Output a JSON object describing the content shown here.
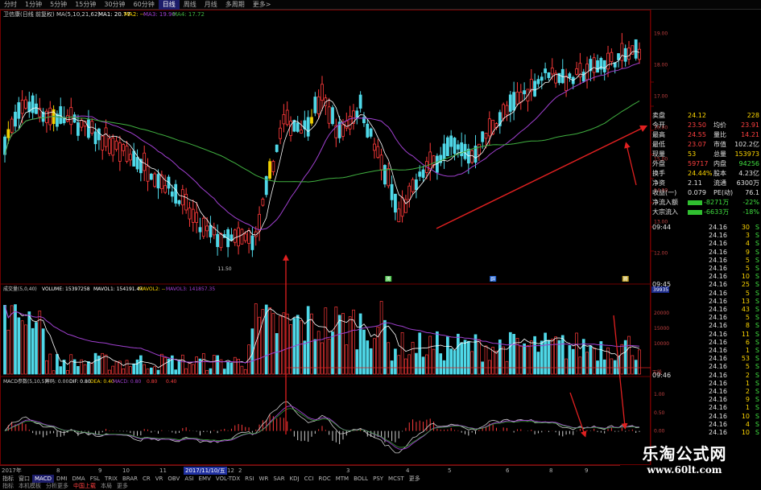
{
  "toolbar": {
    "periods": [
      "分时",
      "1分钟",
      "5分钟",
      "15分钟",
      "30分钟",
      "60分钟",
      "日线",
      "周线",
      "月线",
      "多周期",
      "更多>"
    ],
    "active_period": 6
  },
  "main_legend": {
    "stock_name": "卫信康(日线 前复权)",
    "ma_label": "MA(5,10,21,62)",
    "ma1": "MA1: 20.77",
    "ma2": "MA2: --",
    "ma3": "MA3: 19.90",
    "ma4": "MA4: 17.72"
  },
  "volume_legend": {
    "label": "成交量(5,0,40)",
    "volume": "VOLUME: 15397258",
    "mavol1": "MAVOL1: 154191.47",
    "mavol2": "MAVOL2: --",
    "mavol3": "MAVOL3: 141857.35"
  },
  "macd_legend": {
    "label": "MACD参数(5,10,5)",
    "chip": "筹码: 0.00",
    "dif": "DIF: 0.80",
    "dea": "DEA: 0.40",
    "macd": "MACD: 0.80",
    "extra1": "0.80",
    "extra2": "0.40"
  },
  "price_axis": {
    "ticks": [
      "19.00",
      "18.00",
      "17.00",
      "16.00",
      "15.00",
      "14.00",
      "13.00",
      "12.00"
    ],
    "low_label": "11.50"
  },
  "volume_axis": {
    "ticks": [
      "20000",
      "15000",
      "10000"
    ],
    "badge": "39935",
    "unit": "万股"
  },
  "macd_axis": {
    "ticks": [
      "1.00",
      "0.50",
      "0.00"
    ]
  },
  "event_markers": [
    "腾",
    "辟",
    "腾"
  ],
  "colors": {
    "up": "#ff3a3a",
    "down": "#4fd8e8",
    "yellow_candle": "#f0d000",
    "ma1": "#ffffff",
    "ma3": "#a040d0",
    "ma4": "#40b040",
    "arrow": "#e02020",
    "grid": "#700000"
  },
  "info": {
    "rows": [
      {
        "l": "卖盘",
        "v": "24.12",
        "r": "228",
        "vc": "#ffd700",
        "rc": "#ffd700"
      },
      {
        "l": "今开",
        "v": "23.50",
        "r2": "均价",
        "r": "23.91",
        "vc": "#ff4040",
        "rc": "#ff4040"
      },
      {
        "l": "最高",
        "v": "24.55",
        "r2": "量比",
        "r": "14.21",
        "vc": "#ff4040",
        "rc": "#ff4040"
      },
      {
        "l": "最低",
        "v": "23.07",
        "r2": "市值",
        "r": "102.2亿",
        "vc": "#ff4040",
        "rc": "#e0e0e0"
      },
      {
        "l": "现量",
        "v": "53",
        "r2": "总量",
        "r": "153973",
        "vc": "#ffd700",
        "rc": "#ffd700"
      },
      {
        "l": "外盘",
        "v": "59717",
        "r2": "内盘",
        "r": "94256",
        "vc": "#ff4040",
        "rc": "#40e040"
      },
      {
        "l": "换手",
        "v": "24.44%",
        "r2": "股本",
        "r": "4.23亿",
        "vc": "#ffd700",
        "rc": "#e0e0e0"
      },
      {
        "l": "净资",
        "v": "2.11",
        "r2": "流通",
        "r": "6300万",
        "vc": "#e0e0e0",
        "rc": "#e0e0e0"
      },
      {
        "l": "收益(一)",
        "v": "0.079",
        "r2": "PE(动)",
        "r": "76.1",
        "vc": "#e0e0e0",
        "rc": "#e0e0e0"
      },
      {
        "l": "净流入额",
        "v": "",
        "r2": "-8271万",
        "r": "-22%",
        "vc": "#40e040",
        "rc": "#40e040"
      },
      {
        "l": "大宗流入",
        "v": "",
        "r2": "-6633万",
        "r": "-18%",
        "vc": "#40e040",
        "rc": "#40e040"
      }
    ]
  },
  "ticks": {
    "rows": [
      {
        "t": "09:44",
        "p": "24.16",
        "v": "30",
        "s": "S"
      },
      {
        "t": "",
        "p": "24.16",
        "v": "3",
        "s": "S"
      },
      {
        "t": "",
        "p": "24.16",
        "v": "4",
        "s": "S"
      },
      {
        "t": "",
        "p": "24.16",
        "v": "9",
        "s": "S"
      },
      {
        "t": "",
        "p": "24.16",
        "v": "5",
        "s": "S"
      },
      {
        "t": "",
        "p": "24.16",
        "v": "5",
        "s": "S"
      },
      {
        "t": "",
        "p": "24.16",
        "v": "10",
        "s": "S"
      },
      {
        "t": "09:45",
        "p": "24.16",
        "v": "25",
        "s": "S"
      },
      {
        "t": "",
        "p": "24.16",
        "v": "5",
        "s": "S"
      },
      {
        "t": "",
        "p": "24.16",
        "v": "13",
        "s": "S"
      },
      {
        "t": "",
        "p": "24.16",
        "v": "43",
        "s": "S"
      },
      {
        "t": "",
        "p": "24.16",
        "v": "5",
        "s": "S"
      },
      {
        "t": "",
        "p": "24.16",
        "v": "8",
        "s": "S"
      },
      {
        "t": "",
        "p": "24.16",
        "v": "11",
        "s": "S"
      },
      {
        "t": "",
        "p": "24.16",
        "v": "6",
        "s": "S"
      },
      {
        "t": "",
        "p": "24.16",
        "v": "1",
        "s": "S"
      },
      {
        "t": "",
        "p": "24.16",
        "v": "53",
        "s": "S"
      },
      {
        "t": "",
        "p": "24.16",
        "v": "5",
        "s": "S"
      },
      {
        "t": "09:46",
        "p": "24.16",
        "v": "2",
        "s": "S"
      },
      {
        "t": "",
        "p": "24.16",
        "v": "1",
        "s": "S"
      },
      {
        "t": "",
        "p": "24.16",
        "v": "2",
        "s": "S"
      },
      {
        "t": "",
        "p": "24.16",
        "v": "9",
        "s": "S"
      },
      {
        "t": "",
        "p": "24.16",
        "v": "1",
        "s": "S"
      },
      {
        "t": "",
        "p": "24.16",
        "v": "10",
        "s": "S"
      },
      {
        "t": "",
        "p": "24.16",
        "v": "4",
        "s": "S"
      },
      {
        "t": "",
        "p": "24.16",
        "v": "10",
        "s": "S"
      }
    ]
  },
  "datebar": {
    "labels": [
      "2017年",
      "8",
      "9",
      "10",
      "11",
      "2017/11/10/五",
      "12",
      "2",
      "3",
      "4",
      "5",
      "6",
      "8",
      "9"
    ],
    "selected": 5
  },
  "indicators": {
    "items": [
      "指标",
      "窗口",
      "MACD",
      "DMI",
      "DMA",
      "FSL",
      "TRIX",
      "BRAR",
      "CR",
      "VR",
      "OBV",
      "ASI",
      "EMV",
      "VOL-TDX",
      "RSI",
      "WR",
      "SAR",
      "KDJ",
      "CCI",
      "ROC",
      "MTM",
      "BOLL",
      "PSY",
      "MCST",
      "更多"
    ],
    "active": 2
  },
  "nav": {
    "items": [
      "指标",
      "本机模板",
      "分析更多",
      "中国上载",
      "本局",
      "更多"
    ],
    "highlight": 3
  },
  "watermark": {
    "title": "乐淘公式网",
    "url": "www.60lt.com"
  }
}
